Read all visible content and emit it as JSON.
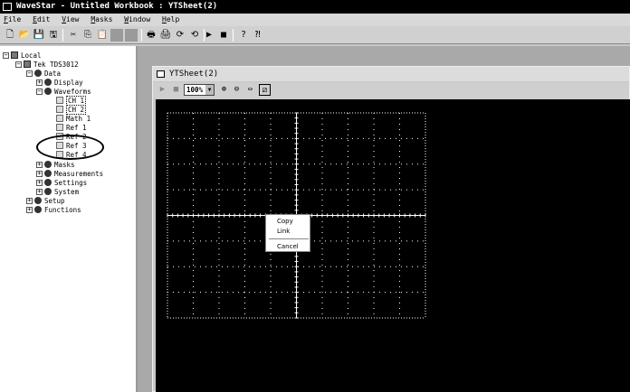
{
  "window": {
    "title": "WaveStar - Untitled Workbook : YTSheet(2)"
  },
  "menu": [
    "File",
    "Edit",
    "View",
    "Masks",
    "Window",
    "Help"
  ],
  "toolbar": {
    "buttons": [
      {
        "name": "new",
        "glyph": "🗋"
      },
      {
        "name": "open",
        "glyph": "📂"
      },
      {
        "name": "save",
        "glyph": "💾"
      },
      {
        "name": "save-all",
        "glyph": "🖫"
      },
      {
        "name": "cut",
        "glyph": "✂"
      },
      {
        "name": "copy",
        "glyph": "⎘"
      },
      {
        "name": "paste",
        "glyph": "📋"
      },
      {
        "name": "disabled-1",
        "glyph": ""
      },
      {
        "name": "disabled-2",
        "glyph": ""
      },
      {
        "name": "print",
        "glyph": "🖶"
      },
      {
        "name": "print-preview",
        "glyph": "🖨"
      },
      {
        "name": "refresh",
        "glyph": "⟳"
      },
      {
        "name": "refresh-all",
        "glyph": "⟲"
      },
      {
        "name": "run",
        "glyph": "▶"
      },
      {
        "name": "stop",
        "glyph": "■"
      },
      {
        "name": "help",
        "glyph": "?"
      },
      {
        "name": "context-help",
        "glyph": "⁈"
      }
    ]
  },
  "tree": {
    "root": "Local",
    "device": "Tek TDS3012",
    "data": "Data",
    "display": "Display",
    "waveforms": "Waveforms",
    "ch1": "CH 1",
    "ch2": "CH 2",
    "math1": "Math 1",
    "ref1": "Ref 1",
    "ref2": "Ref 2",
    "ref3": "Ref 3",
    "ref4": "Ref 4",
    "masks": "Masks",
    "measurements": "Measurements",
    "settings": "Settings",
    "system": "System",
    "setup": "Setup",
    "functions": "Functions"
  },
  "sheet": {
    "title": "YTSheet(2)",
    "zoom": "100%",
    "zoom_arrow": "▼"
  },
  "context_menu": {
    "copy": "Copy",
    "link": "Link",
    "cancel": "Cancel"
  },
  "colors": {
    "scope_background": "#000000",
    "graticule": "#ffffff",
    "titlebar": "#000000"
  }
}
